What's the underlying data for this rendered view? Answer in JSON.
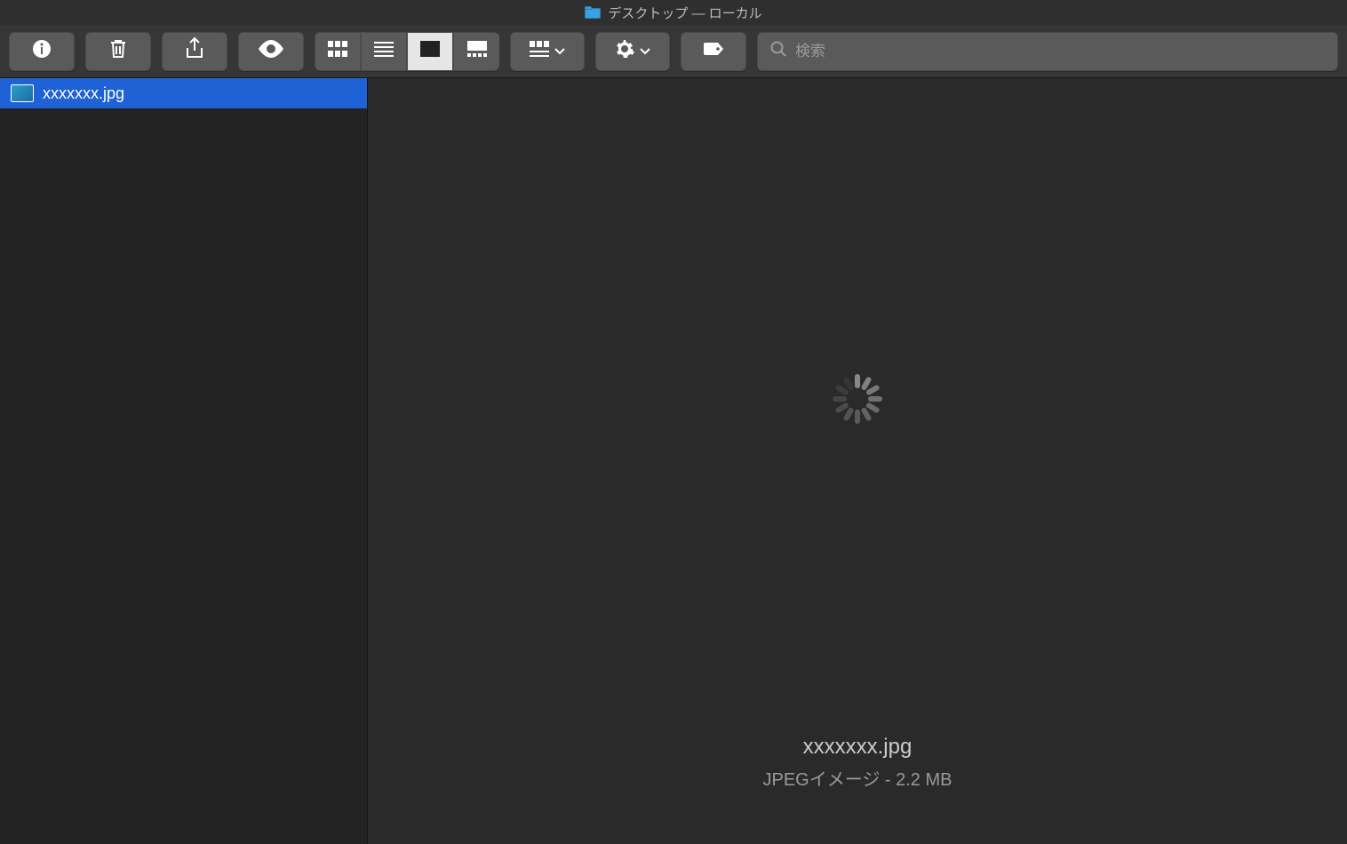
{
  "window": {
    "title": "デスクトップ — ローカル"
  },
  "toolbar": {
    "search_placeholder": "検索"
  },
  "sidebar": {
    "files": [
      {
        "name": "xxxxxxx.jpg",
        "selected": true
      }
    ]
  },
  "preview": {
    "filename": "xxxxxxx.jpg",
    "subtitle": "JPEGイメージ - 2.2 MB"
  }
}
